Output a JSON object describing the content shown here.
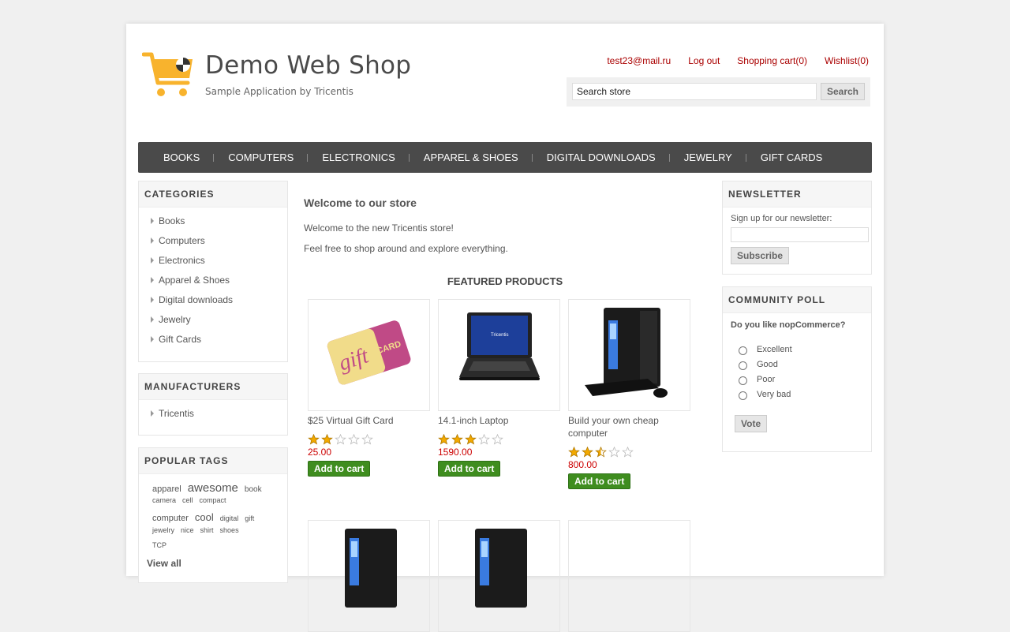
{
  "header": {
    "title": "Demo Web Shop",
    "subtitle": "Sample Application by Tricentis",
    "links": {
      "email": "test23@mail.ru",
      "logout": "Log out",
      "cart": "Shopping cart(0)",
      "wishlist": "Wishlist(0)"
    },
    "search": {
      "value": "Search store",
      "button": "Search"
    }
  },
  "menu": [
    "BOOKS",
    "COMPUTERS",
    "ELECTRONICS",
    "APPAREL & SHOES",
    "DIGITAL DOWNLOADS",
    "JEWELRY",
    "GIFT CARDS"
  ],
  "categories": {
    "title": "CATEGORIES",
    "items": [
      "Books",
      "Computers",
      "Electronics",
      "Apparel & Shoes",
      "Digital downloads",
      "Jewelry",
      "Gift Cards"
    ]
  },
  "manufacturers": {
    "title": "MANUFACTURERS",
    "items": [
      "Tricentis"
    ]
  },
  "tags": {
    "title": "POPULAR TAGS",
    "rows": [
      [
        "apparel",
        "awesome",
        "book"
      ],
      [
        "camera",
        "cell",
        "compact"
      ],
      [
        "computer",
        "cool",
        "digital",
        "gift"
      ],
      [
        "jewelry",
        "nice",
        "shirt",
        "shoes"
      ],
      [
        "TCP"
      ]
    ],
    "view_all": "View all"
  },
  "main": {
    "welcome_title": "Welcome to our store",
    "welcome_p1": "Welcome to the new Tricentis store!",
    "welcome_p2": "Feel free to shop around and explore everything.",
    "featured_title": "FEATURED PRODUCTS",
    "products": [
      {
        "title": "$25 Virtual Gift Card",
        "rating": 2,
        "price": "25.00",
        "button": "Add to cart",
        "image": "gift-card"
      },
      {
        "title": "14.1-inch Laptop",
        "rating": 3,
        "price": "1590.00",
        "button": "Add to cart",
        "image": "laptop"
      },
      {
        "title": "Build your own cheap computer",
        "rating": 2.5,
        "price": "800.00",
        "button": "Add to cart",
        "image": "desktop"
      }
    ]
  },
  "newsletter": {
    "title": "NEWSLETTER",
    "label": "Sign up for our newsletter:",
    "button": "Subscribe"
  },
  "poll": {
    "title": "COMMUNITY POLL",
    "question": "Do you like nopCommerce?",
    "options": [
      "Excellent",
      "Good",
      "Poor",
      "Very bad"
    ],
    "button": "Vote"
  },
  "colors": {
    "accent": "#aa0000",
    "menu_bg": "#4a4a4a",
    "cart_button": "#3f8d1f",
    "price": "#cc0000",
    "logo": "#f8b32d"
  }
}
